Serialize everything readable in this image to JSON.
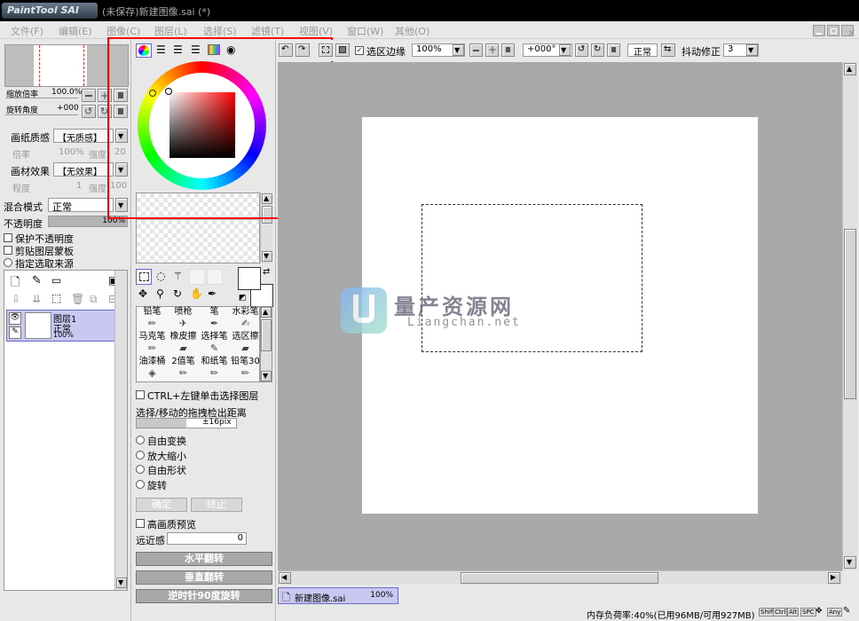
{
  "app": {
    "logo_text": "PaintTool SAI",
    "title": "(未保存)新建图像.sai (*)"
  },
  "menu": [
    "文件(F)",
    "编辑(E)",
    "图像(C)",
    "图层(L)",
    "选择(S)",
    "滤镜(T)",
    "视图(V)",
    "窗口(W)",
    "其他(O)"
  ],
  "navigator": {
    "zoom_label": "缩放倍率",
    "zoom_value": "100.0%",
    "rotate_label": "旋转角度",
    "rotate_value": "+000"
  },
  "paper": {
    "texture_label": "画纸质感",
    "texture_value": "【无质感】",
    "texture_scale_label": "倍率",
    "texture_scale_value": "100%",
    "texture_strength_label": "强度",
    "texture_strength_value": "20",
    "effect_label": "画材效果",
    "effect_value": "【无效果】",
    "effect_degree_label": "程度",
    "effect_degree_value": "1",
    "effect_strength_label": "强度",
    "effect_strength_value": "100"
  },
  "layer_props": {
    "blend_label": "混合模式",
    "blend_value": "正常",
    "opacity_label": "不透明度",
    "opacity_value": "100%",
    "opacity_fraction": 1.0,
    "preserve_opacity": "保护不透明度",
    "clipping": "剪贴图层蒙板",
    "selection_source": "指定选取来源"
  },
  "layers": [
    {
      "name": "图层1",
      "mode": "正常",
      "opacity": "100%"
    }
  ],
  "tools": [
    {
      "name": "铅笔",
      "icon": "pencil-icon"
    },
    {
      "name": "喷枪",
      "icon": "airbrush-icon"
    },
    {
      "name": "笔",
      "icon": "pen-icon"
    },
    {
      "name": "水彩笔",
      "icon": "watercolor-icon"
    },
    {
      "name": "马克笔",
      "icon": "marker-icon"
    },
    {
      "name": "橡皮擦",
      "icon": "eraser-icon"
    },
    {
      "name": "选择笔",
      "icon": "select-pen-icon"
    },
    {
      "name": "选区擦",
      "icon": "select-eraser-icon"
    },
    {
      "name": "油漆桶",
      "icon": "bucket-icon"
    },
    {
      "name": "2值笔",
      "icon": "binary-pen-icon"
    },
    {
      "name": "和纸笔",
      "icon": "washi-pen-icon"
    },
    {
      "name": "铅笔30",
      "icon": "pencil-icon"
    }
  ],
  "tool_options": {
    "ctrl_click": "CTRL+左键单击选择图层",
    "drag_label": "选择/移动的拖拽检出距离",
    "drag_value": "±16pix",
    "free_transform": "自由变换",
    "scale": "放大缩小",
    "free_shape": "自由形状",
    "rotate": "旋转",
    "ok": "确定",
    "cancel": "终止",
    "hq_preview": "高画质预览",
    "perspective_label": "远近感",
    "perspective_value": "0",
    "flip_h": "水平翻转",
    "flip_v": "垂直翻转",
    "rotate_ccw": "逆时针90度旋转"
  },
  "toolbar": {
    "selection_edge_label": "选区边缘",
    "zoom_value": "100%",
    "angle_value": "+000°",
    "blend_value": "正常",
    "stabilizer_label": "抖动修正",
    "stabilizer_value": "3"
  },
  "watermark": {
    "title": "量产资源网",
    "subtitle": "Liangchan.net"
  },
  "doc_tab": {
    "name": "新建图像.sai",
    "zoom": "100%"
  },
  "status": {
    "memory": "内存负荷率:40%(已用96MB/可用927MB)",
    "keys": [
      "Shift",
      "Ctrl",
      "Alt",
      "SPC",
      "Any"
    ]
  },
  "colors": {
    "accent_red": "#ff0000",
    "layer_selected": "#c8c8f0",
    "canvas_bg": "#a9a9a9"
  }
}
